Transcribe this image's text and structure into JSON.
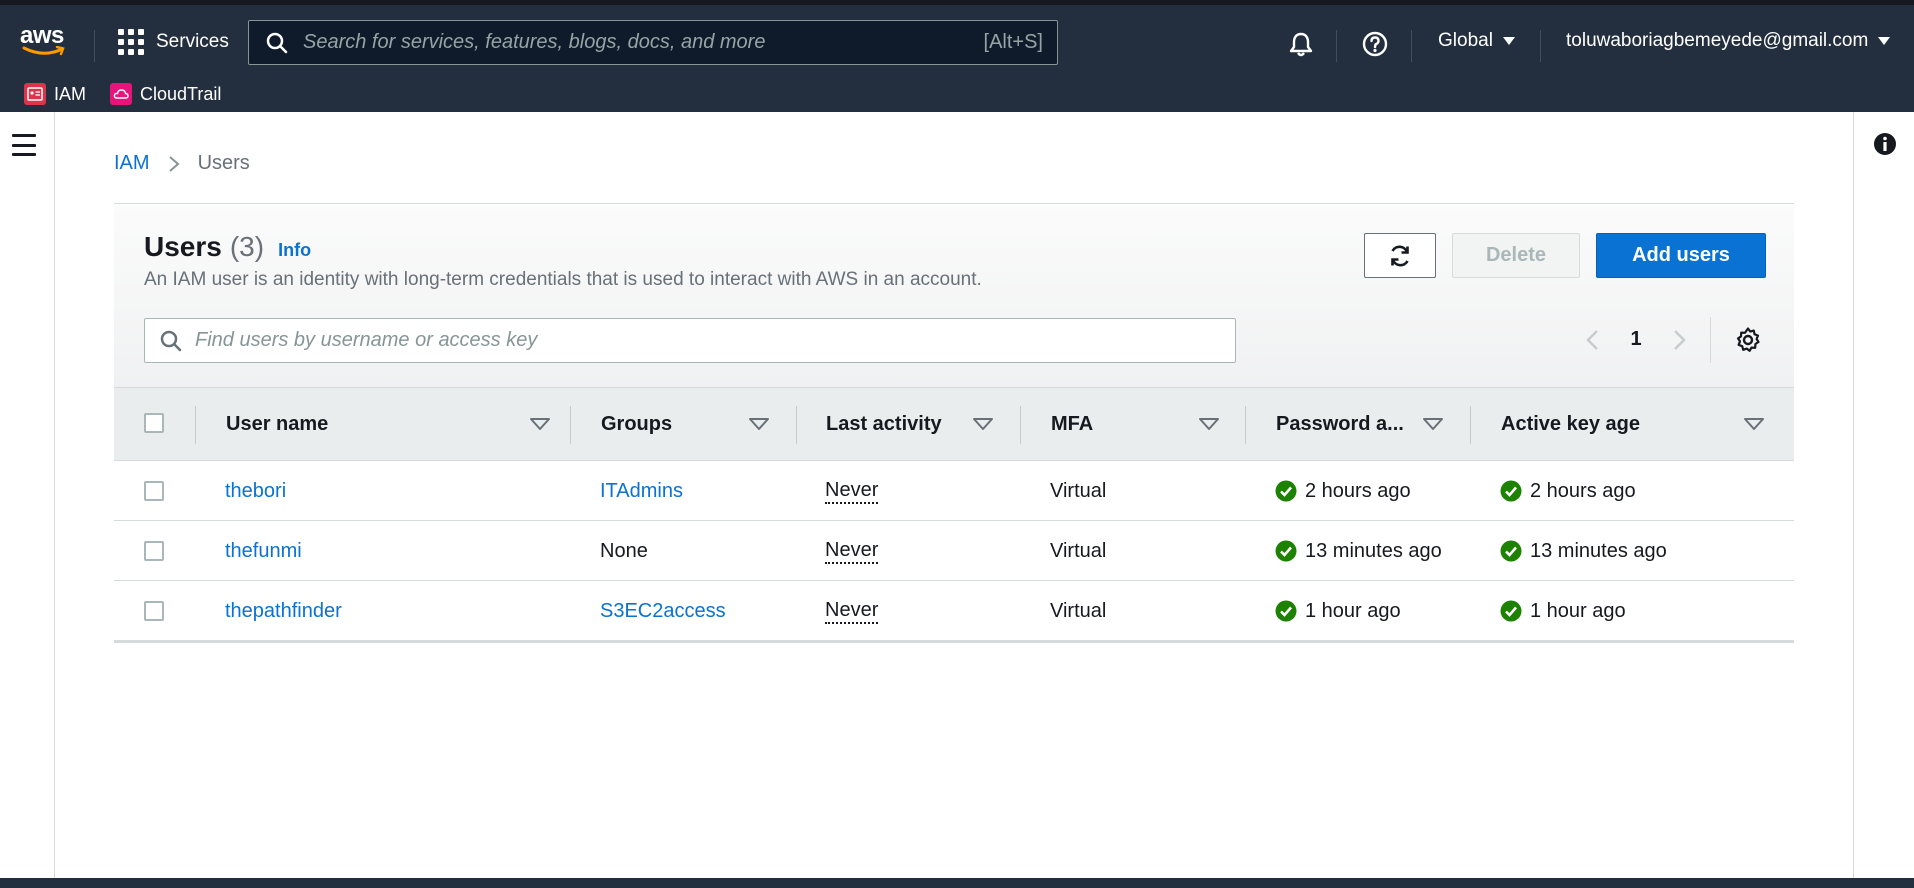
{
  "nav": {
    "logo_text": "aws",
    "services_label": "Services",
    "search_placeholder": "Search for services, features, blogs, docs, and more",
    "search_shortcut": "[Alt+S]",
    "region_label": "Global",
    "account_label": "toluwaboriagbemeyede@gmail.com",
    "favorites": [
      {
        "label": "IAM",
        "color": "#dd344c"
      },
      {
        "label": "CloudTrail",
        "color": "#e7157b"
      }
    ]
  },
  "breadcrumb": {
    "root": "IAM",
    "current": "Users"
  },
  "panel": {
    "title": "Users",
    "count": "(3)",
    "info_link": "Info",
    "description": "An IAM user is an identity with long-term credentials that is used to interact with AWS in an account.",
    "delete_label": "Delete",
    "add_label": "Add users",
    "filter_placeholder": "Find users by username or access key",
    "page_number": "1"
  },
  "table": {
    "columns": [
      "User name",
      "Groups",
      "Last activity",
      "MFA",
      "Password a...",
      "Active key age"
    ],
    "rows": [
      {
        "username": "thebori",
        "groups": "ITAdmins",
        "groups_is_link": true,
        "last_activity": "Never",
        "mfa": "Virtual",
        "password_age": "2 hours ago",
        "key_age": "2 hours ago"
      },
      {
        "username": "thefunmi",
        "groups": "None",
        "groups_is_link": false,
        "last_activity": "Never",
        "mfa": "Virtual",
        "password_age": "13 minutes ago",
        "key_age": "13 minutes ago"
      },
      {
        "username": "thepathfinder",
        "groups": "S3EC2access",
        "groups_is_link": true,
        "last_activity": "Never",
        "mfa": "Virtual",
        "password_age": "1 hour ago",
        "key_age": "1 hour ago"
      }
    ]
  },
  "colors": {
    "nav_bg": "#232f3e",
    "link": "#0972d3",
    "primary_button": "#0972d3",
    "success": "#1d8102"
  }
}
